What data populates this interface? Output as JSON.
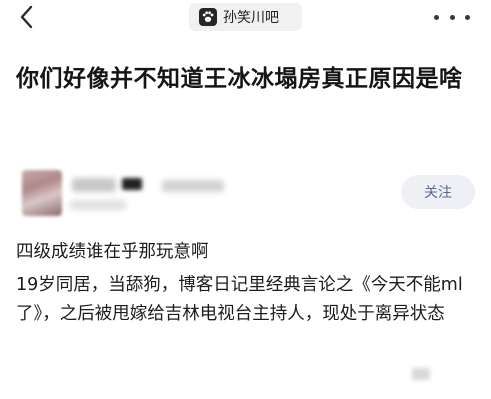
{
  "topbar": {
    "back_icon": "chevron-left-icon",
    "forum_icon": "paw-icon",
    "forum_name": "孙笑川吧",
    "more_icon": "more-dots-icon"
  },
  "post": {
    "title": "你们好像并不知道王冰冰塌房真正原因是啥",
    "follow_label": "关注",
    "paragraphs": [
      "四级成绩谁在乎那玩意啊",
      "19岁同居，当舔狗，博客日记里经典言论之《今天不能ml了》，之后被甩嫁给吉林电视台主持人，现处于离异状态"
    ]
  },
  "colors": {
    "follow_bg": "#eef0f5",
    "follow_text": "#5a6b8c",
    "chip_bg": "#f1f1f1"
  }
}
